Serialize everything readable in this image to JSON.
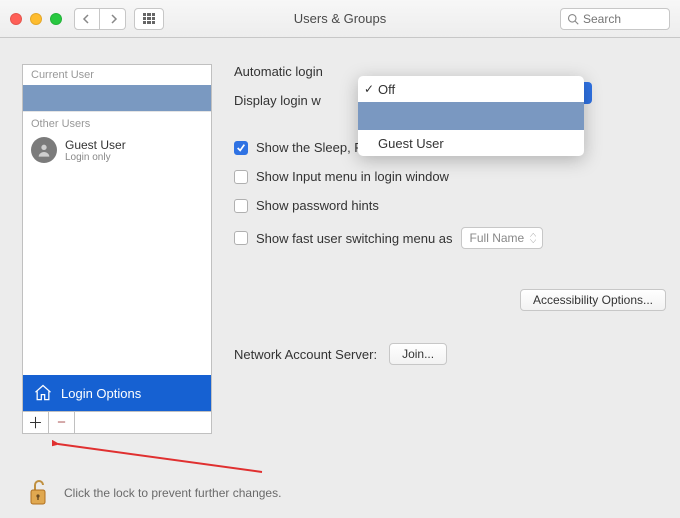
{
  "window": {
    "title": "Users & Groups",
    "search_placeholder": "Search"
  },
  "sidebar": {
    "current_header": "Current User",
    "other_header": "Other Users",
    "guest": {
      "name": "Guest User",
      "sub": "Login only"
    },
    "login_options": "Login Options"
  },
  "dropdown": {
    "auto_login_label": "Automatic login",
    "display_label": "Display login w",
    "off": "Off",
    "guest": "Guest User"
  },
  "checks": {
    "sleep": "Show the Sleep, Restart, and Shut Down buttons",
    "input_menu": "Show Input menu in login window",
    "pw_hints": "Show password hints",
    "fast_switch": "Show fast user switching menu as",
    "fast_switch_value": "Full Name"
  },
  "buttons": {
    "accessibility": "Accessibility Options...",
    "join": "Join...",
    "net_label": "Network Account Server:"
  },
  "footer": {
    "text": "Click the lock to prevent further changes."
  }
}
